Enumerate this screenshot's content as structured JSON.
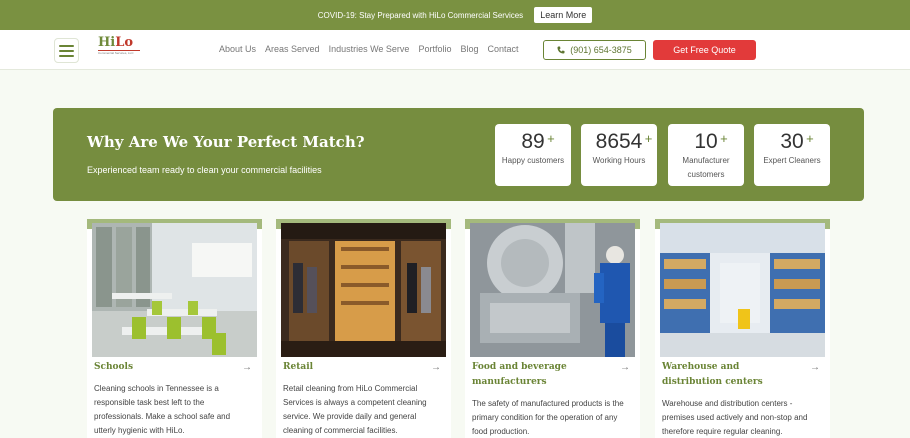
{
  "announcement": {
    "text": "COVID-19: Stay Prepared with HiLo Commercial Services",
    "button": "Learn More"
  },
  "header": {
    "logo_hi": "Hi",
    "logo_lo": "Lo",
    "logo_sub": "Commercial Services, LLC",
    "nav": [
      "About Us",
      "Areas Served",
      "Industries We Serve",
      "Portfolio",
      "Blog",
      "Contact"
    ],
    "phone": "(901) 654-3875",
    "quote_button": "Get Free Quote"
  },
  "match": {
    "title": "Why Are We Your Perfect Match?",
    "subtitle": "Experienced team ready to clean your commercial facilities",
    "stats": [
      {
        "value": "89",
        "plus": "+",
        "label": "Happy customers"
      },
      {
        "value": "8654",
        "plus": "+",
        "label": "Working Hours"
      },
      {
        "value": "10",
        "plus": "+",
        "label": "Manufacturer customers"
      },
      {
        "value": "30",
        "plus": "+",
        "label": "Expert Cleaners"
      }
    ]
  },
  "cards": [
    {
      "title": "Schools",
      "text": "Cleaning schools in Tennessee is a responsible task best left to the professionals. Make a school safe and utterly hygienic with HiLo.",
      "arrow": "→"
    },
    {
      "title": "Retail",
      "text": "Retail cleaning from HiLo Commercial Services is always a competent cleaning service. We provide daily and general cleaning of commercial facilities.",
      "arrow": "→"
    },
    {
      "title": "Food and beverage manufacturers",
      "text": "The safety of manufactured products is the primary condition for the operation of any food production.",
      "arrow": "→"
    },
    {
      "title": "Warehouse and distribution centers",
      "text": "Warehouse and distribution centers - premises used actively and non-stop and therefore require regular cleaning.",
      "arrow": "→"
    }
  ],
  "colors": {
    "brand_green": "#768d3f",
    "accent_red": "#e23a3a",
    "page_background": "#f7faf3"
  }
}
